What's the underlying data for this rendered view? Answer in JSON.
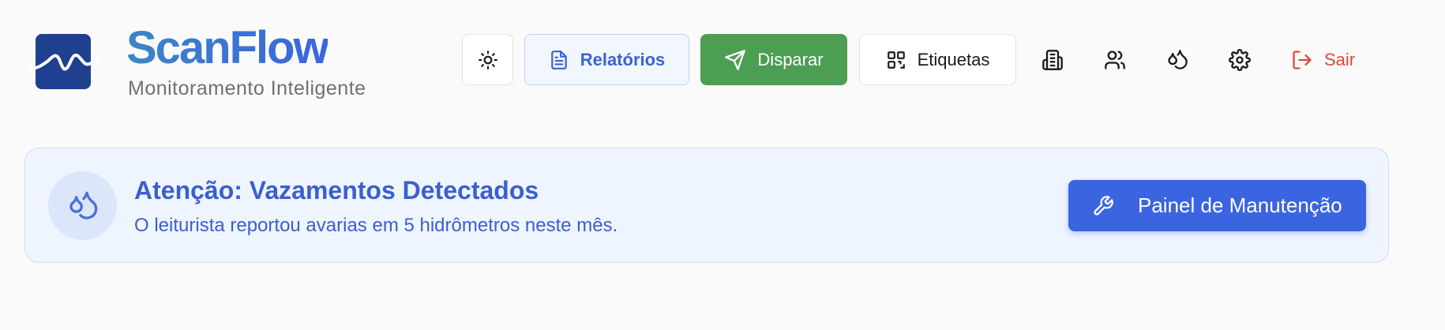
{
  "brand": {
    "title": "ScanFlow",
    "subtitle": "Monitoramento Inteligente"
  },
  "toolbar": {
    "theme_icon": "sun-icon",
    "reports_label": "Relatórios",
    "send_label": "Disparar",
    "labels_label": "Etiquetas",
    "icons": [
      "building-icon",
      "users-icon",
      "droplets-icon",
      "gear-icon"
    ],
    "exit_label": "Sair"
  },
  "alert": {
    "title": "Atenção: Vazamentos Detectados",
    "message": "O leiturista reportou avarias em 5 hidrômetros neste mês.",
    "action_label": "Painel de Manutenção"
  },
  "colors": {
    "primary": "#3b64e0",
    "success": "#4c9e52",
    "danger": "#d94b3c",
    "logo_bg": "#1f3f8f"
  }
}
